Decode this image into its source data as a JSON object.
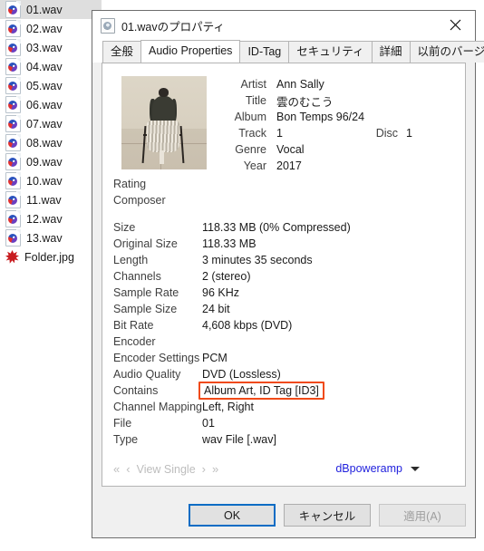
{
  "filelist": {
    "items": [
      {
        "name": "01.wav",
        "icon": "wav-file-icon",
        "selected": true
      },
      {
        "name": "02.wav",
        "icon": "wav-file-icon",
        "selected": false
      },
      {
        "name": "03.wav",
        "icon": "wav-file-icon",
        "selected": false
      },
      {
        "name": "04.wav",
        "icon": "wav-file-icon",
        "selected": false
      },
      {
        "name": "05.wav",
        "icon": "wav-file-icon",
        "selected": false
      },
      {
        "name": "06.wav",
        "icon": "wav-file-icon",
        "selected": false
      },
      {
        "name": "07.wav",
        "icon": "wav-file-icon",
        "selected": false
      },
      {
        "name": "08.wav",
        "icon": "wav-file-icon",
        "selected": false
      },
      {
        "name": "09.wav",
        "icon": "wav-file-icon",
        "selected": false
      },
      {
        "name": "10.wav",
        "icon": "wav-file-icon",
        "selected": false
      },
      {
        "name": "11.wav",
        "icon": "wav-file-icon",
        "selected": false
      },
      {
        "name": "12.wav",
        "icon": "wav-file-icon",
        "selected": false
      },
      {
        "name": "13.wav",
        "icon": "wav-file-icon",
        "selected": false
      },
      {
        "name": "Folder.jpg",
        "icon": "image-file-icon",
        "selected": false
      }
    ]
  },
  "dialog": {
    "title": "01.wavのプロパティ",
    "title_icon": "audio-file-icon",
    "close_icon": "close-icon",
    "tabs": [
      {
        "label": "全般",
        "active": false
      },
      {
        "label": "Audio Properties",
        "active": true
      },
      {
        "label": "ID-Tag",
        "active": false
      },
      {
        "label": "セキュリティ",
        "active": false
      },
      {
        "label": "詳細",
        "active": false
      },
      {
        "label": "以前のバージョン",
        "active": false
      }
    ]
  },
  "tags": {
    "artist_label": "Artist",
    "artist_value": "Ann Sally",
    "title_label": "Title",
    "title_value": "雲のむこう",
    "album_label": "Album",
    "album_value": "Bon Temps 96/24",
    "track_label": "Track",
    "track_value": "1",
    "disc_label": "Disc",
    "disc_value": "1",
    "genre_label": "Genre",
    "genre_value": "Vocal",
    "year_label": "Year",
    "year_value": "2017"
  },
  "details": {
    "group_a": [
      {
        "label": "Rating",
        "value": ""
      },
      {
        "label": "Composer",
        "value": ""
      }
    ],
    "group_b": [
      {
        "label": "Size",
        "value": "118.33 MB  (0% Compressed)"
      },
      {
        "label": "Original Size",
        "value": "118.33 MB"
      },
      {
        "label": "Length",
        "value": "3 minutes 35 seconds"
      },
      {
        "label": "Channels",
        "value": "2  (stereo)"
      },
      {
        "label": "Sample Rate",
        "value": "96 KHz"
      },
      {
        "label": "Sample Size",
        "value": "24 bit"
      },
      {
        "label": "Bit Rate",
        "value": "4,608 kbps  (DVD)"
      }
    ],
    "group_c": [
      {
        "label": "Encoder",
        "value": "",
        "highlighted": false
      },
      {
        "label": "Encoder Settings",
        "value": "PCM",
        "highlighted": false
      },
      {
        "label": "Audio Quality",
        "value": "DVD  (Lossless)",
        "highlighted": false
      },
      {
        "label": "Contains",
        "value": "Album Art, ID Tag [ID3]",
        "highlighted": true
      },
      {
        "label": "Channel Mapping",
        "value": "Left, Right",
        "highlighted": false
      },
      {
        "label": "File",
        "value": "01",
        "highlighted": false
      },
      {
        "label": "Type",
        "value": "wav File   [.wav]",
        "highlighted": false
      }
    ]
  },
  "pagefoot": {
    "first_icon": "chevron-double-left-icon",
    "prev_icon": "chevron-left-icon",
    "view_mode_label": "View Single",
    "next_icon": "chevron-right-icon",
    "last_icon": "chevron-double-right-icon",
    "brand_link": "dBpoweramp",
    "brand_caret_icon": "caret-down-icon"
  },
  "buttons": {
    "ok": "OK",
    "cancel": "キャンセル",
    "apply": "適用(A)"
  },
  "colors": {
    "highlight_box": "#f04a18",
    "link": "#2222dd",
    "focus_border": "#0a6cc4",
    "selection_bg": "#dedede"
  }
}
